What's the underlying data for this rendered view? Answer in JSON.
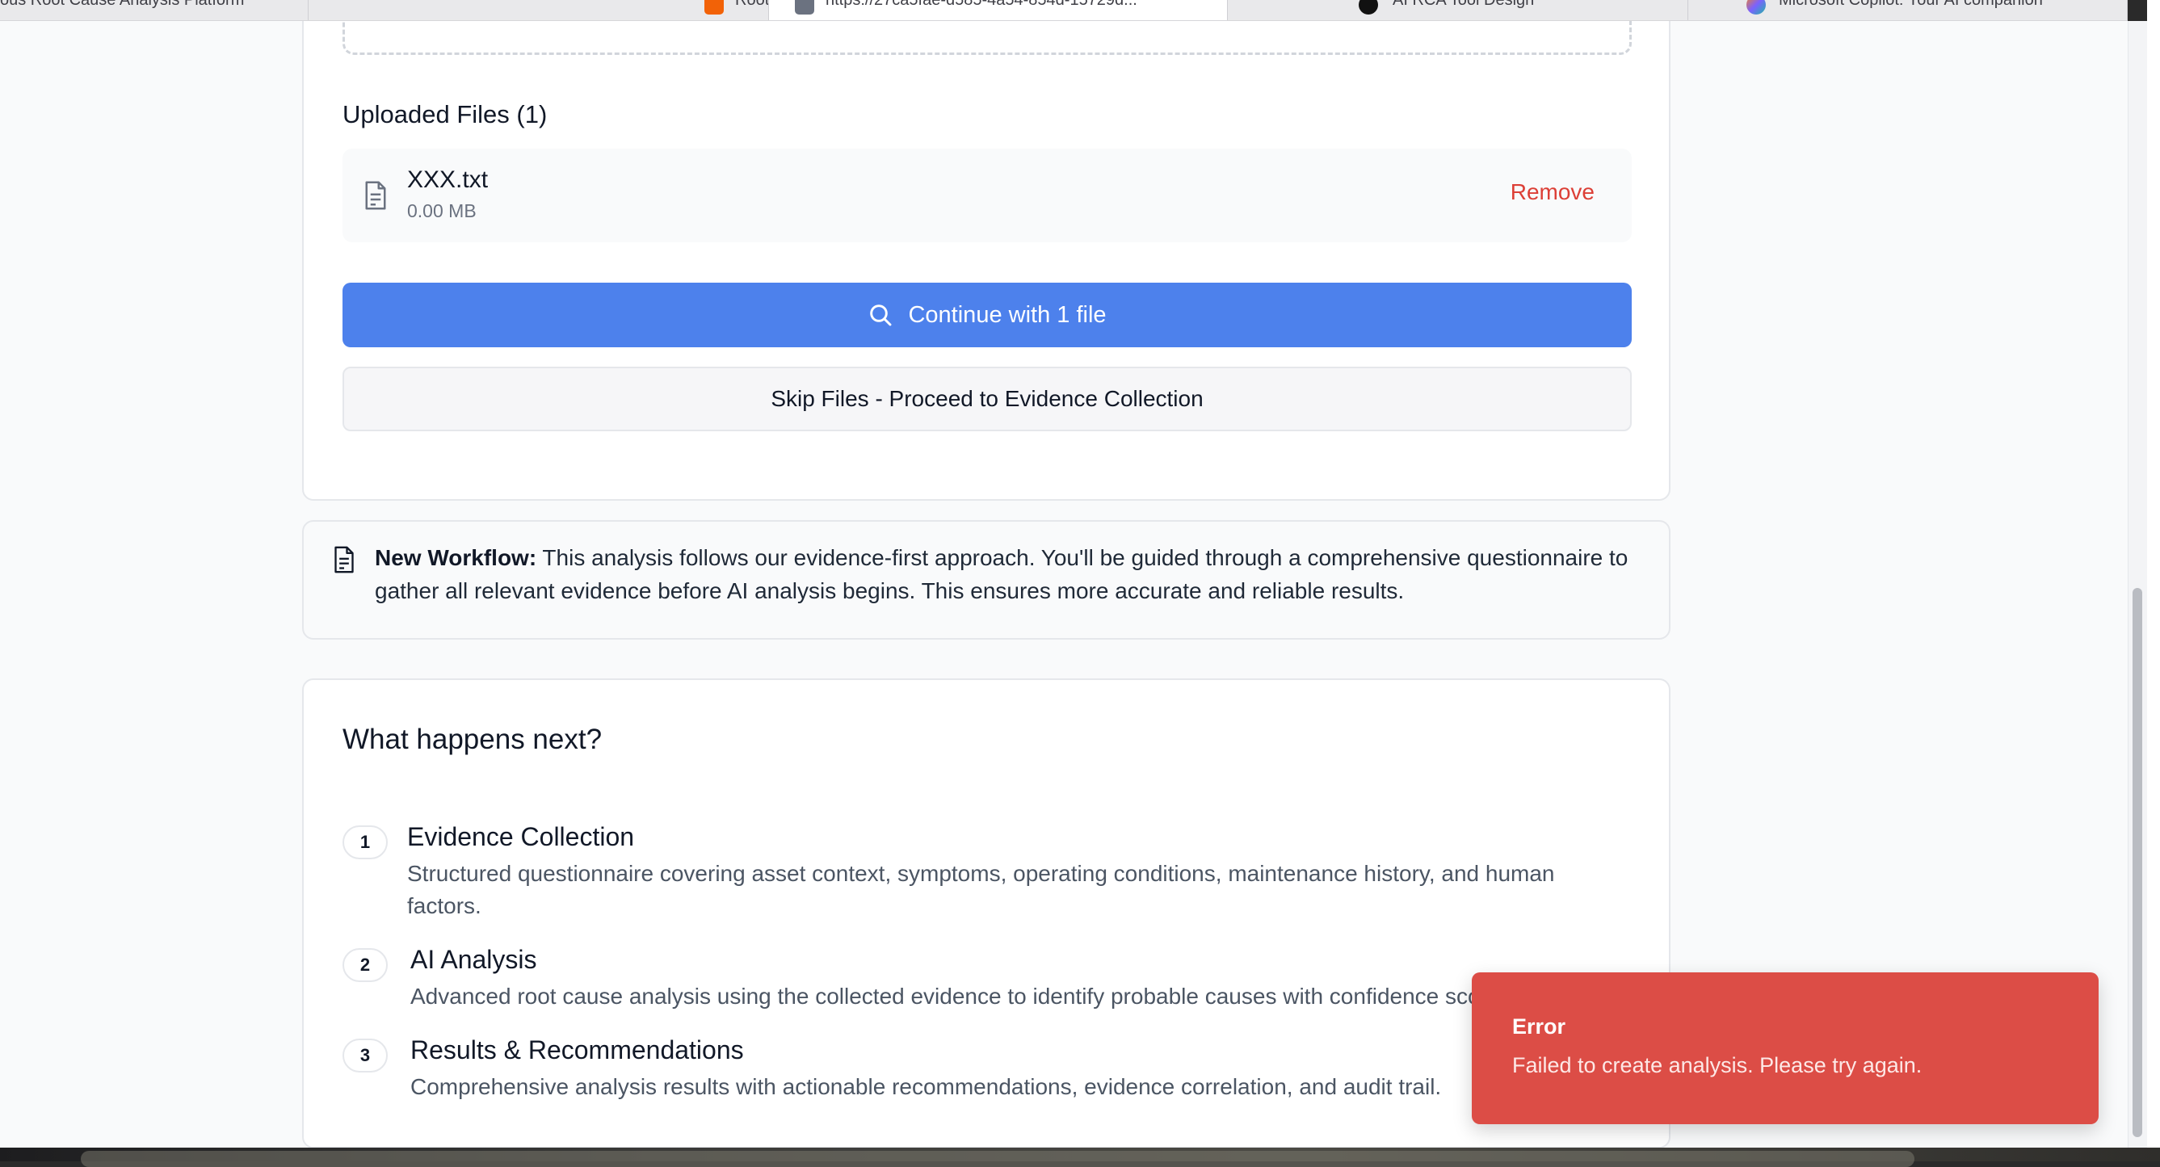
{
  "browser": {
    "tabs": [
      {
        "title": "ous Root Cause Analysis Platform",
        "active": false,
        "favicon_color": ""
      },
      {
        "title": "RootCauseIntelligence - Replit",
        "active": false,
        "favicon_color": "#f26207"
      },
      {
        "title": "https://27ca5fae-d585-4a54-854d-15729d...",
        "active": true,
        "favicon_color": "#6b7280"
      },
      {
        "title": "AI RCA Tool Design",
        "active": false,
        "favicon_color": "#111111"
      },
      {
        "title": "Microsoft Copilot: Your AI companion",
        "active": false,
        "favicon_color": "#7b61ff"
      }
    ]
  },
  "upload": {
    "uploaded_title": "Uploaded Files (1)",
    "file": {
      "name": "XXX.txt",
      "size": "0.00 MB",
      "icon": "file-text-icon"
    },
    "remove_label": "Remove",
    "continue_label": "Continue with 1 file",
    "continue_icon": "search-icon",
    "skip_label": "Skip Files - Proceed to Evidence Collection"
  },
  "notice": {
    "icon": "file-text-icon",
    "label": "New Workflow:",
    "text": " This analysis follows our evidence-first approach. You'll be guided through a comprehensive questionnaire to gather all relevant evidence before AI analysis begins. This ensures more accurate and reliable results."
  },
  "next": {
    "title": "What happens next?",
    "steps": [
      {
        "num": "1",
        "title": "Evidence Collection",
        "desc": "Structured questionnaire covering asset context, symptoms, operating conditions, maintenance history, and human factors."
      },
      {
        "num": "2",
        "title": "AI Analysis",
        "desc": "Advanced root cause analysis using the collected evidence to identify probable causes with confidence scores."
      },
      {
        "num": "3",
        "title": "Results & Recommendations",
        "desc": "Comprehensive analysis results with actionable recommendations, evidence correlation, and audit trail."
      }
    ]
  },
  "toast": {
    "title": "Error",
    "message": "Failed to create analysis. Please try again.",
    "color": "#dc4d46"
  },
  "colors": {
    "primary": "#4d81ec",
    "danger": "#dc3f36"
  }
}
